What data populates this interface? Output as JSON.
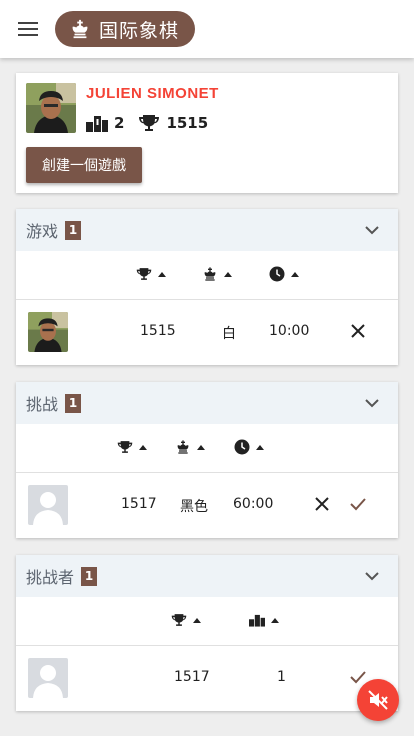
{
  "header": {
    "app_title": "国际象棋",
    "menu_icon": "hamburger-icon",
    "logo_icon": "chess-king-icon"
  },
  "profile": {
    "name": "JULIEN SIMONET",
    "rank": "2",
    "rating": "1515",
    "create_game_label": "創建一個遊戲"
  },
  "games": {
    "title": "游戏",
    "count": "1",
    "row": {
      "rating": "1515",
      "color": "白",
      "time": "10:00"
    }
  },
  "challenges": {
    "title": "挑战",
    "count": "1",
    "row": {
      "rating": "1517",
      "color": "黑色",
      "time": "60:00"
    }
  },
  "challengers": {
    "title": "挑战者",
    "count": "1",
    "row": {
      "rating": "1517",
      "rank": "1"
    }
  },
  "colors": {
    "brand": "#795548",
    "accent_red": "#f44336",
    "section_bg": "#eef3f7"
  }
}
